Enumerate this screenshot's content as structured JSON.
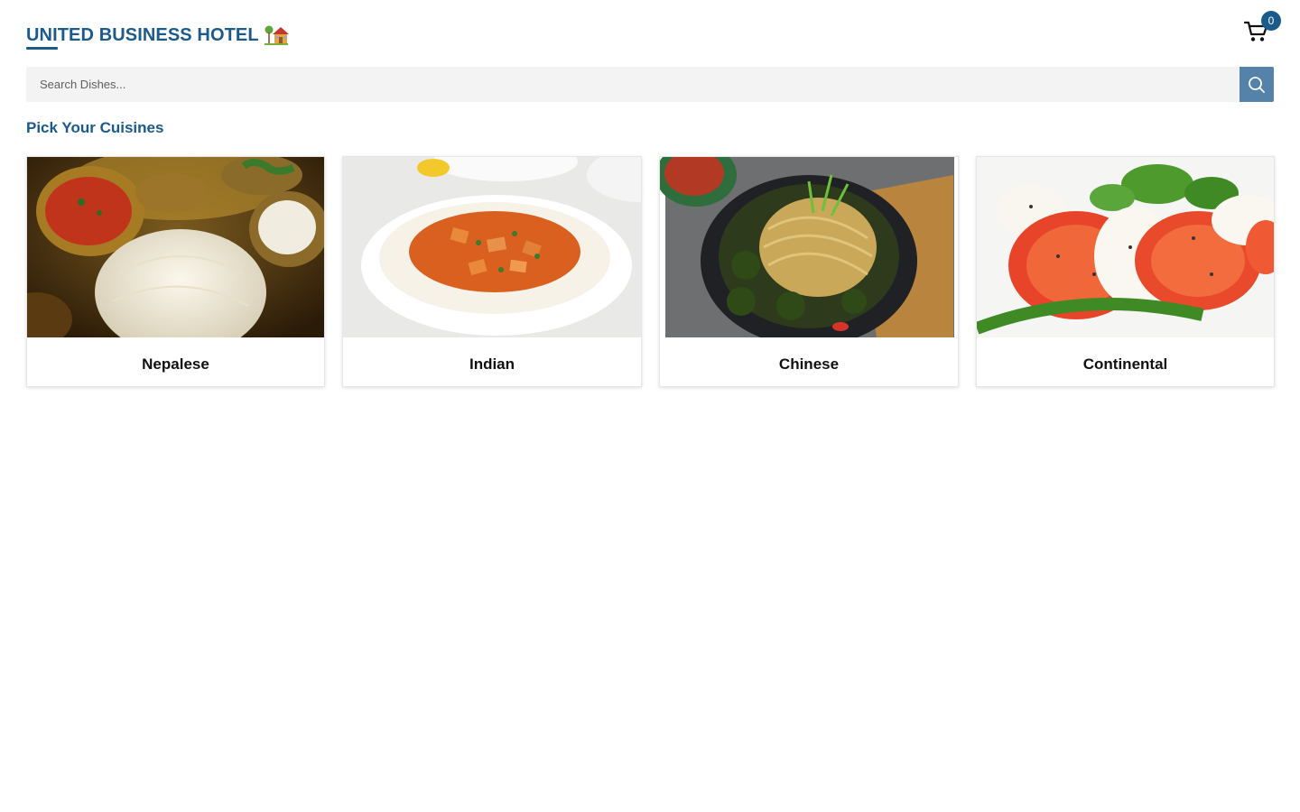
{
  "header": {
    "brand_title": "UNITED BUSINESS HOTEL",
    "brand_icon": "house-with-tree-icon",
    "cart_icon": "shopping-cart-icon",
    "cart_count": "0"
  },
  "search": {
    "placeholder": "Search Dishes...",
    "value": "",
    "button_icon": "search-icon"
  },
  "section": {
    "title": "Pick Your Cuisines"
  },
  "cuisines": [
    {
      "label": "Nepalese",
      "image": "nepalese-thali-rice-curry"
    },
    {
      "label": "Indian",
      "image": "indian-paneer-curry-rice-bowl"
    },
    {
      "label": "Chinese",
      "image": "chinese-noodles-manchurian-bowl"
    },
    {
      "label": "Continental",
      "image": "continental-caprese-salad"
    }
  ],
  "colors": {
    "brand": "#1b5a8a",
    "search_bg": "#f3f3f3",
    "search_button": "#5482a8",
    "badge": "#1b5a8a"
  }
}
